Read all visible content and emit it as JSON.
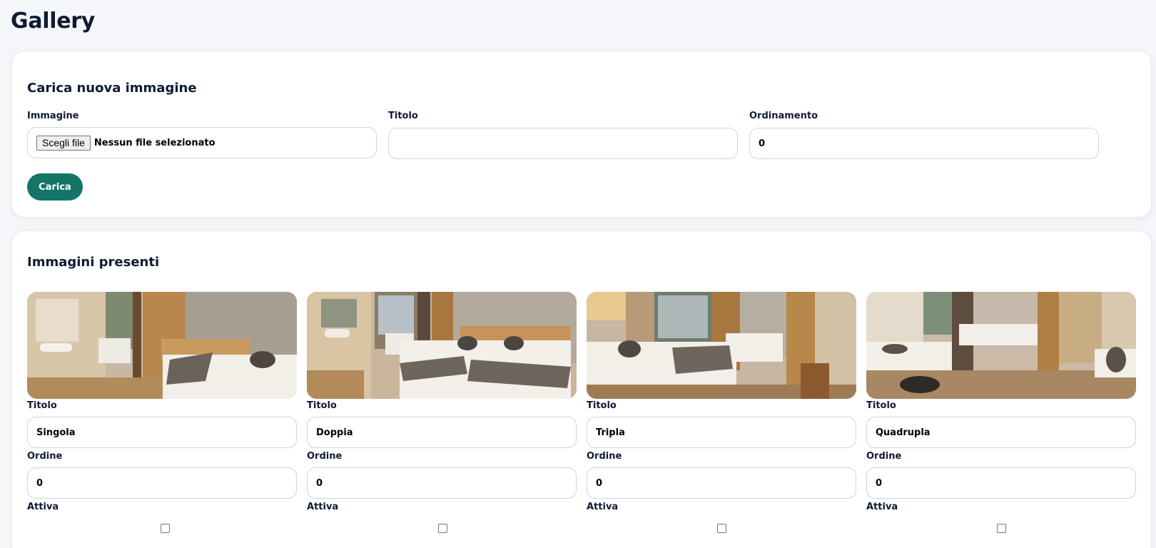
{
  "page": {
    "title": "Gallery"
  },
  "upload": {
    "heading": "Carica nuova immagine",
    "image_label": "Immagine",
    "file_button": "Scegli file",
    "file_status": "Nessun file selezionato",
    "title_label": "Titolo",
    "title_value": "",
    "order_label": "Ordinamento",
    "order_value": "0",
    "submit_label": "Carica"
  },
  "gallery": {
    "heading": "Immagini presenti",
    "items": [
      {
        "title_label": "Titolo",
        "title_value": "Singola",
        "order_label": "Ordine",
        "order_value": "0",
        "active_label": "Attiva",
        "active": false
      },
      {
        "title_label": "Titolo",
        "title_value": "Doppia",
        "order_label": "Ordine",
        "order_value": "0",
        "active_label": "Attiva",
        "active": false
      },
      {
        "title_label": "Titolo",
        "title_value": "Tripla",
        "order_label": "Ordine",
        "order_value": "0",
        "active_label": "Attiva",
        "active": false
      },
      {
        "title_label": "Titolo",
        "title_value": "Quadrupla",
        "order_label": "Ordine",
        "order_value": "0",
        "active_label": "Attiva",
        "active": false
      }
    ]
  },
  "colors": {
    "accent": "#137567",
    "background": "#f4f6fa",
    "heading": "#101a33"
  }
}
